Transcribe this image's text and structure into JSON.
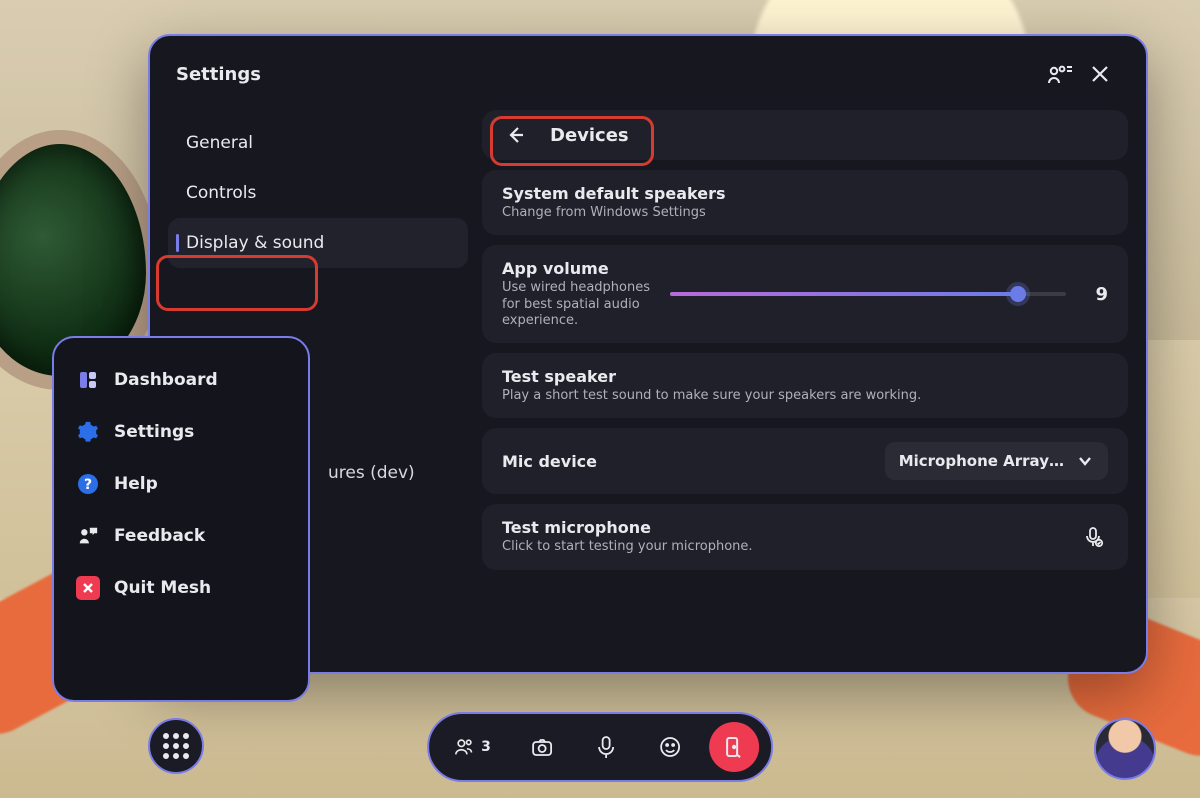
{
  "window": {
    "title": "Settings"
  },
  "sidebar": {
    "items": [
      {
        "label": "General"
      },
      {
        "label": "Controls"
      },
      {
        "label": "Display & sound"
      },
      {
        "label": "ures (dev)"
      }
    ],
    "active_index": 2
  },
  "content": {
    "header": {
      "title": "Devices"
    },
    "speakers": {
      "title": "System default speakers",
      "sub": "Change from Windows Settings"
    },
    "volume": {
      "title": "App volume",
      "sub": "Use wired headphones for best spatial audio experience.",
      "value": 9,
      "max": 10,
      "fill_pct": 88
    },
    "test_speaker": {
      "title": "Test speaker",
      "sub": "Play a short test sound to make sure your speakers are working."
    },
    "mic": {
      "title": "Mic device",
      "selected": "Microphone Array…"
    },
    "test_mic": {
      "title": "Test microphone",
      "sub": "Click to start testing your microphone."
    }
  },
  "menu": {
    "items": [
      {
        "label": "Dashboard",
        "icon": "dashboard",
        "color": "#7a7ce8"
      },
      {
        "label": "Settings",
        "icon": "gear",
        "color": "#2b6fe8"
      },
      {
        "label": "Help",
        "icon": "help",
        "color": "#2b6fe8"
      },
      {
        "label": "Feedback",
        "icon": "feedback",
        "color": "#e9e9ee"
      },
      {
        "label": "Quit Mesh",
        "icon": "quit",
        "color": "#ef3b52"
      }
    ],
    "highlighted_index": 1
  },
  "bottombar": {
    "participants": 3
  },
  "colors": {
    "accent": "#7a7ce8",
    "danger": "#ef3b52",
    "annotation": "#d73b2f"
  }
}
